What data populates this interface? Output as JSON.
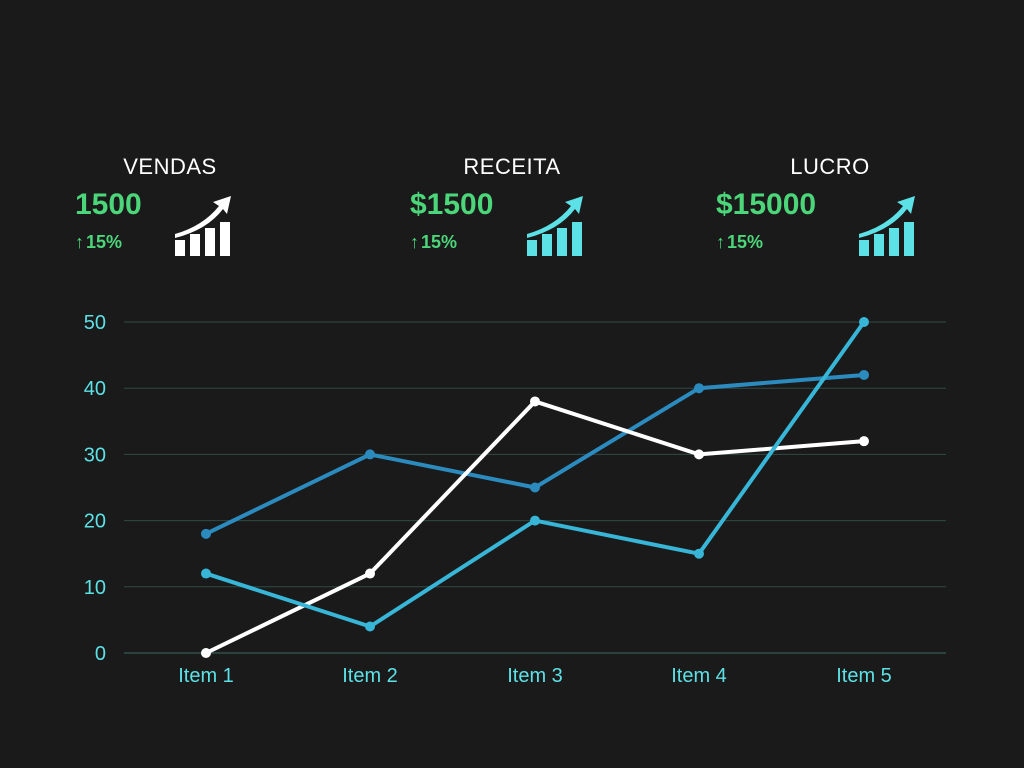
{
  "kpis": [
    {
      "label": "VENDAS",
      "value": "1500",
      "delta": "15%",
      "icon": "growth-chart-icon",
      "icon_color": "#ffffff"
    },
    {
      "label": "RECEITA",
      "value": "$1500",
      "delta": "15%",
      "icon": "growth-chart-icon",
      "icon_color": "#5ce1e6"
    },
    {
      "label": "LUCRO",
      "value": "$15000",
      "delta": "15%",
      "icon": "growth-chart-icon",
      "icon_color": "#5ce1e6"
    }
  ],
  "colors": {
    "background": "#1a1a1a",
    "accent_green": "#4cd67a",
    "axis_text": "#5ce1e6",
    "grid": "#2e4a45"
  },
  "chart_data": {
    "type": "line",
    "categories": [
      "Item 1",
      "Item 2",
      "Item 3",
      "Item 4",
      "Item 5"
    ],
    "series": [
      {
        "values": [
          18,
          30,
          25,
          40,
          42
        ],
        "color": "#2b8bbf"
      },
      {
        "values": [
          0,
          12,
          38,
          30,
          32
        ],
        "color": "#ffffff"
      },
      {
        "values": [
          12,
          4,
          20,
          15,
          50
        ],
        "color": "#38b6d8"
      }
    ],
    "yticks": [
      0,
      10,
      20,
      30,
      40,
      50
    ],
    "ylim": [
      0,
      50
    ],
    "grid": true,
    "legend": "none"
  }
}
